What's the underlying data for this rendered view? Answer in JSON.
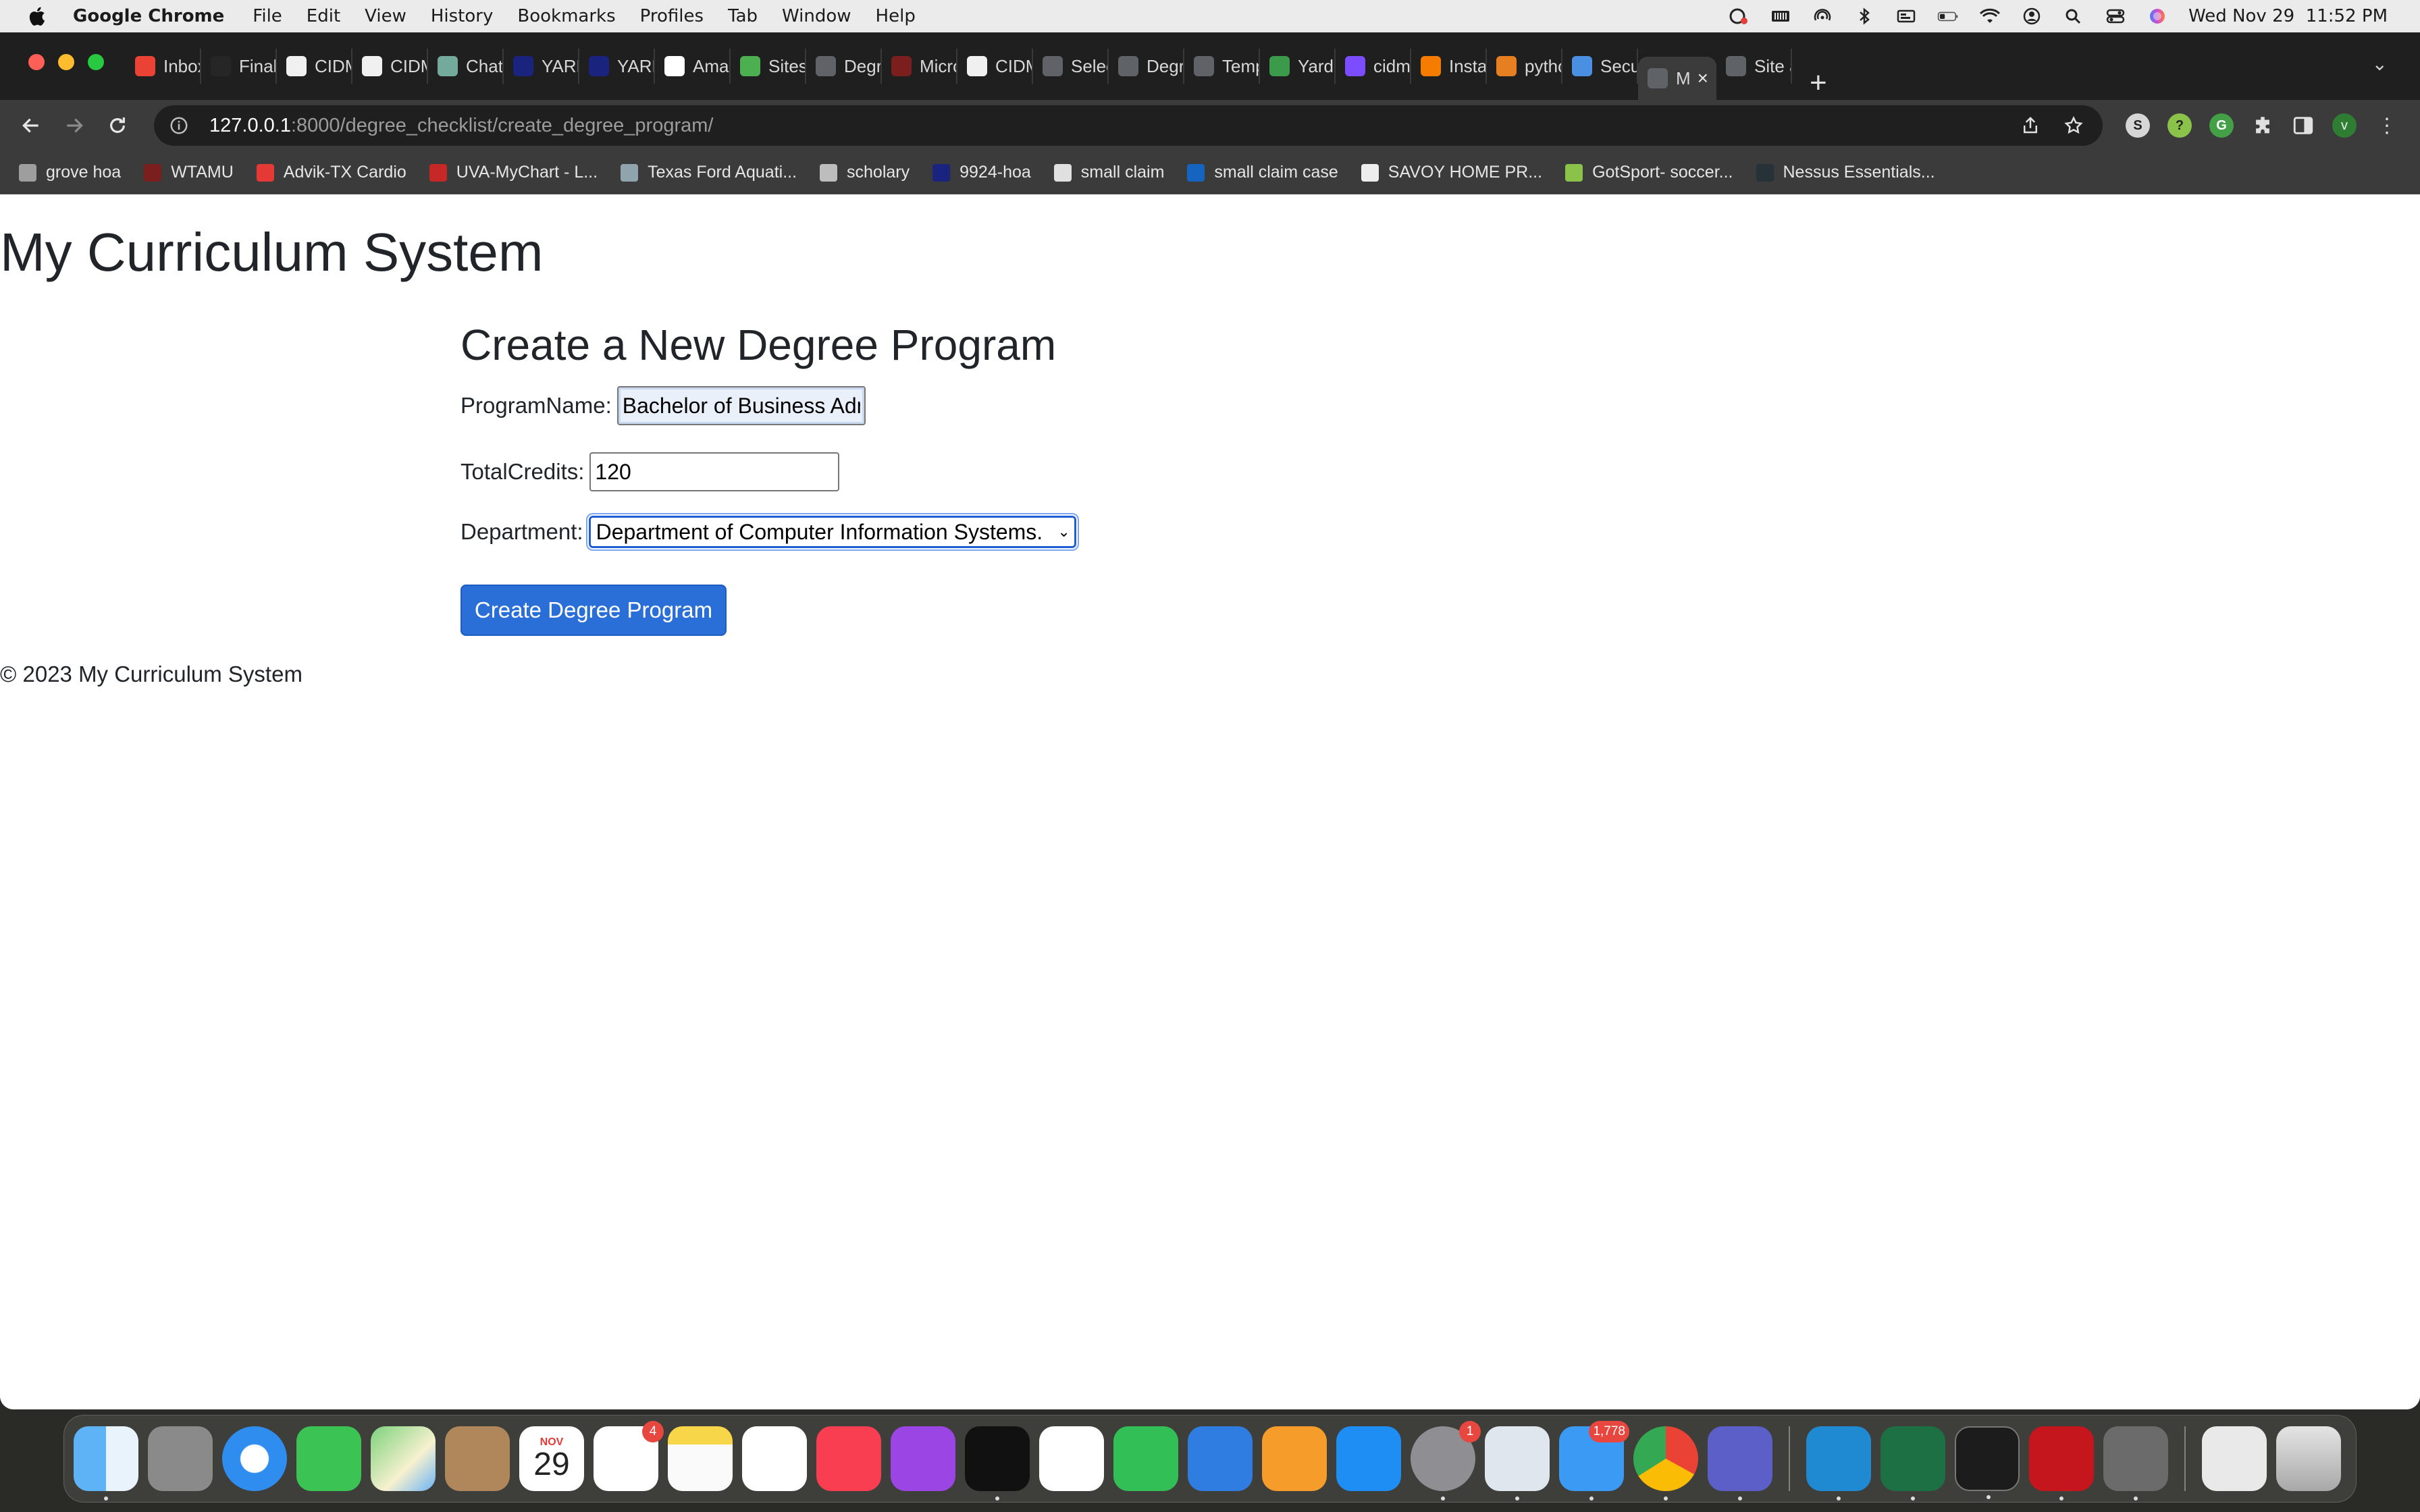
{
  "menubar": {
    "app_name": "Google Chrome",
    "items": [
      "File",
      "Edit",
      "View",
      "History",
      "Bookmarks",
      "Profiles",
      "Tab",
      "Window",
      "Help"
    ],
    "clock": "Wed Nov 29  11:52 PM"
  },
  "tabs": [
    {
      "label": "Inbox",
      "icon": "gmail-icon",
      "color": "#ea4335"
    },
    {
      "label": "Final",
      "icon": "blackboard-icon",
      "color": "#262626"
    },
    {
      "label": "CIDM",
      "icon": "github-icon",
      "color": "#f0f0f0"
    },
    {
      "label": "CIDM",
      "icon": "github-icon",
      "color": "#f0f0f0"
    },
    {
      "label": "ChatG",
      "icon": "chatgpt-icon",
      "color": "#74aa9c"
    },
    {
      "label": "YARD",
      "icon": "yardi-icon",
      "color": "#1a237e"
    },
    {
      "label": "YARD",
      "icon": "yardi-icon",
      "color": "#1a237e"
    },
    {
      "label": "Amaz",
      "icon": "amazon-icon",
      "color": "#ffffff"
    },
    {
      "label": "Sites",
      "icon": "sites-icon",
      "color": "#4caf50"
    },
    {
      "label": "Degre",
      "icon": "globe-icon",
      "color": "#5f6368"
    },
    {
      "label": "Micro",
      "icon": "wtamu-icon",
      "color": "#7b1e1e"
    },
    {
      "label": "CIDM",
      "icon": "github-icon",
      "color": "#f0f0f0"
    },
    {
      "label": "Selec",
      "icon": "globe-icon",
      "color": "#5f6368"
    },
    {
      "label": "Degre",
      "icon": "globe-icon",
      "color": "#5f6368"
    },
    {
      "label": "Temp",
      "icon": "globe-icon",
      "color": "#5f6368"
    },
    {
      "label": "Yardi",
      "icon": "yardi-icon",
      "color": "#3c9a4b"
    },
    {
      "label": "cidm",
      "icon": "app-icon",
      "color": "#7c4dff"
    },
    {
      "label": "Instar",
      "icon": "app-icon",
      "color": "#f57c00"
    },
    {
      "label": "pytho",
      "icon": "python-icon",
      "color": "#e67e22"
    },
    {
      "label": "Secur",
      "icon": "puzzle-icon",
      "color": "#4a90e2"
    },
    {
      "label": "M",
      "icon": "globe-icon",
      "color": "#5f6368",
      "active": true
    },
    {
      "label": "Site a",
      "icon": "globe-icon",
      "color": "#5f6368"
    }
  ],
  "address_bar": {
    "host": "127.0.0.1",
    "path": ":8000/degree_checklist/create_degree_program/"
  },
  "bookmarks": [
    {
      "label": "grove hoa",
      "color": "#9e9e9e"
    },
    {
      "label": "WTAMU",
      "color": "#7b1e1e"
    },
    {
      "label": "Advik-TX Cardio",
      "color": "#e53935"
    },
    {
      "label": "UVA-MyChart - L...",
      "color": "#c62828"
    },
    {
      "label": "Texas Ford Aquati...",
      "color": "#90a4ae"
    },
    {
      "label": "scholary",
      "color": "#bdbdbd"
    },
    {
      "label": "9924-hoa",
      "color": "#1a237e"
    },
    {
      "label": "small claim",
      "color": "#e0e0e0"
    },
    {
      "label": "small claim case",
      "color": "#1565c0"
    },
    {
      "label": "SAVOY HOME PR...",
      "color": "#eeeeee"
    },
    {
      "label": "GotSport- soccer...",
      "color": "#8bc34a"
    },
    {
      "label": "Nessus Essentials...",
      "color": "#263238"
    }
  ],
  "page": {
    "site_title": "My Curriculum System",
    "form_title": "Create a New Degree Program",
    "program_name_label": "ProgramName:",
    "program_name_value": "Bachelor of Business Adm",
    "total_credits_label": "TotalCredits:",
    "total_credits_value": "120",
    "department_label": "Department:",
    "department_value": "Department of Computer Information Systems.",
    "submit_label": "Create Degree Program",
    "footer": "© 2023 My Curriculum System"
  },
  "dock": {
    "calendar_month": "NOV",
    "calendar_day": "29",
    "reminders_badge": "4",
    "settings_badge": "1",
    "mail_badge": "1,778"
  },
  "colors": {
    "accent": "#2a6ed8",
    "select_focus": "#1f5fd6"
  }
}
